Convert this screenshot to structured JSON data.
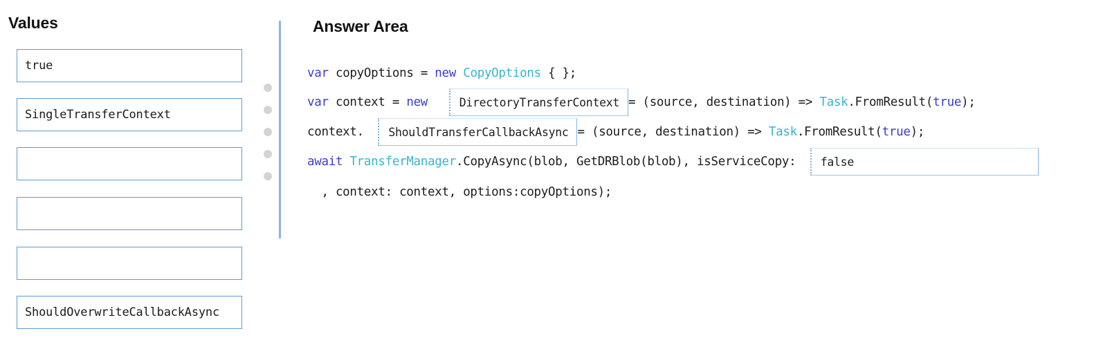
{
  "values_panel": {
    "title": "Values",
    "items": [
      {
        "label": "true"
      },
      {
        "label": "SingleTransferContext"
      },
      {
        "label": ""
      },
      {
        "label": ""
      },
      {
        "label": ""
      },
      {
        "label": "ShouldOverwriteCallbackAsync"
      }
    ],
    "drag_handle_dots": 5
  },
  "answer_panel": {
    "title": "Answer Area",
    "code_lines": [
      {
        "id": "line-1",
        "tokens": [
          {
            "text": "var",
            "kind": "keyword"
          },
          {
            "text": " copyOptions = ",
            "kind": "plain"
          },
          {
            "text": "new",
            "kind": "keyword"
          },
          {
            "text": " ",
            "kind": "plain"
          },
          {
            "text": "CopyOptions",
            "kind": "type"
          },
          {
            "text": " { };",
            "kind": "plain"
          }
        ]
      },
      {
        "id": "line-2",
        "tokens": [
          {
            "text": "var",
            "kind": "keyword"
          },
          {
            "text": " context = ",
            "kind": "plain"
          },
          {
            "text": "new",
            "kind": "keyword"
          },
          {
            "text": "   ",
            "kind": "plain"
          },
          {
            "text": "DirectoryTransferContext",
            "kind": "slot"
          },
          {
            "text": "= (source, destination) => ",
            "kind": "plain"
          },
          {
            "text": "Task",
            "kind": "type"
          },
          {
            "text": ".FromResult(",
            "kind": "plain"
          },
          {
            "text": "true",
            "kind": "keyword"
          },
          {
            "text": ");",
            "kind": "plain"
          }
        ]
      },
      {
        "id": "line-3",
        "tokens": [
          {
            "text": "context.  ",
            "kind": "plain"
          },
          {
            "text": "ShouldTransferCallbackAsync",
            "kind": "slot"
          },
          {
            "text": "= (source, destination) => ",
            "kind": "plain"
          },
          {
            "text": "Task",
            "kind": "type"
          },
          {
            "text": ".FromResult(",
            "kind": "plain"
          },
          {
            "text": "true",
            "kind": "keyword"
          },
          {
            "text": ");",
            "kind": "plain"
          }
        ]
      },
      {
        "id": "line-4",
        "tokens": [
          {
            "text": "await",
            "kind": "keyword"
          },
          {
            "text": " ",
            "kind": "plain"
          },
          {
            "text": "TransferManager",
            "kind": "type"
          },
          {
            "text": ".CopyAsync(blob, GetDRBlob(blob), isServiceCopy:  ",
            "kind": "plain"
          },
          {
            "text": "false",
            "kind": "slot-wide"
          }
        ]
      },
      {
        "id": "line-5",
        "tokens": [
          {
            "text": "  , context: context, options:copyOptions);",
            "kind": "plain"
          }
        ]
      }
    ]
  },
  "colors": {
    "keyword": "#3b3bd4",
    "type": "#39b5cd",
    "plain": "#1d1d1d",
    "box_border": "#5b9bd5",
    "divider": "#8ab4df",
    "drag_dot": "#d4d4d4"
  }
}
